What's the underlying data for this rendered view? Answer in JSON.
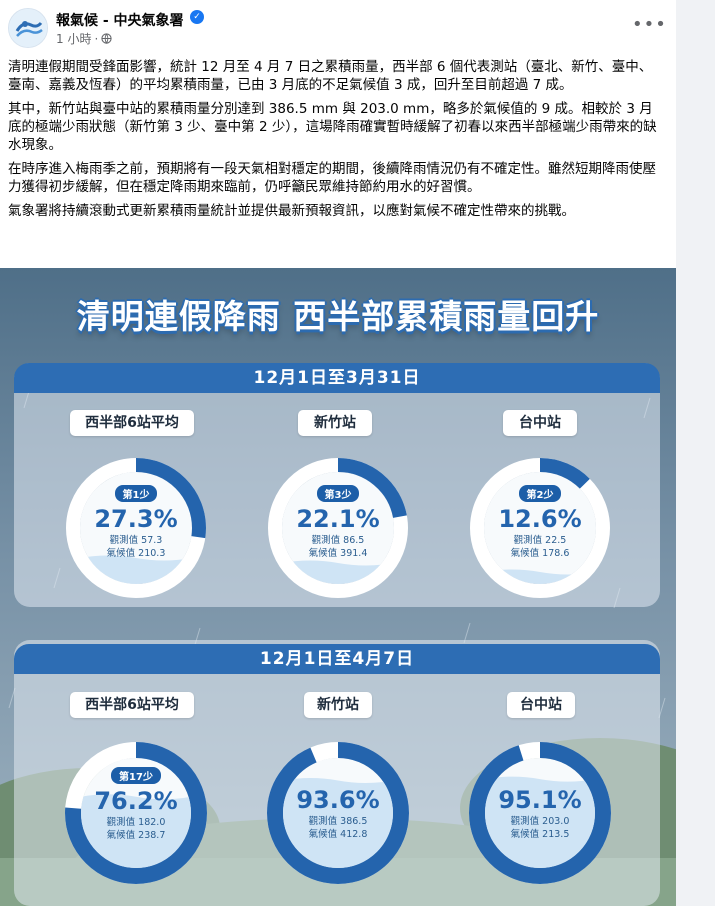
{
  "post": {
    "page_name": "報氣候 - 中央氣象署",
    "verified": "✓",
    "time": "1 小時",
    "more": "•••",
    "paragraphs": [
      "清明連假期間受鋒面影響，統計 12 月至 4 月 7 日之累積雨量，西半部 6 個代表測站（臺北、新竹、臺中、臺南、嘉義及恆春）的平均累積雨量，已由 3 月底的不足氣候值 3 成，回升至目前超過 7 成。",
      "其中，新竹站與臺中站的累積雨量分別達到 386.5 mm 與 203.0 mm，略多於氣候值的 9 成。相較於 3 月底的極端少雨狀態（新竹第 3 少、臺中第 2 少），這場降雨確實暫時緩解了初春以來西半部極端少雨帶來的缺水現象。",
      "在時序進入梅雨季之前，預期將有一段天氣相對穩定的期間，後續降雨情況仍有不確定性。雖然短期降雨使壓力獲得初步緩解，但在穩定降雨期來臨前，仍呼籲民眾維持節約用水的好習慣。",
      "氣象署將持續滾動式更新累積雨量統計並提供最新預報資訊，以應對氣候不確定性帶來的挑戰。"
    ]
  },
  "infographic": {
    "title": "清明連假降雨 西半部累積雨量回升",
    "period_1": "12月1日至3月31日",
    "period_2": "12月1日至4月7日",
    "colors": {
      "ring": "#2464ad",
      "track": "#ffffff",
      "banner": "#2d6db4"
    },
    "top_row": [
      {
        "station": "西半部6站平均",
        "rank": "第1少",
        "percent_label": "27.3%",
        "fraction": 0.273,
        "observed": "觀測值 57.3",
        "climate": "氣候值 210.3"
      },
      {
        "station": "新竹站",
        "rank": "第3少",
        "percent_label": "22.1%",
        "fraction": 0.221,
        "observed": "觀測值 86.5",
        "climate": "氣候值 391.4"
      },
      {
        "station": "台中站",
        "rank": "第2少",
        "percent_label": "12.6%",
        "fraction": 0.126,
        "observed": "觀測值 22.5",
        "climate": "氣候值 178.6"
      }
    ],
    "bottom_row": [
      {
        "station": "西半部6站平均",
        "rank": "第17少",
        "percent_label": "76.2%",
        "fraction": 0.762,
        "observed": "觀測值 182.0",
        "climate": "氣候值 238.7"
      },
      {
        "station": "新竹站",
        "rank": "",
        "percent_label": "93.6%",
        "fraction": 0.936,
        "observed": "觀測值 386.5",
        "climate": "氣候值 412.8"
      },
      {
        "station": "台中站",
        "rank": "",
        "percent_label": "95.1%",
        "fraction": 0.951,
        "observed": "觀測值 203.0",
        "climate": "氣候值 213.5"
      }
    ]
  }
}
